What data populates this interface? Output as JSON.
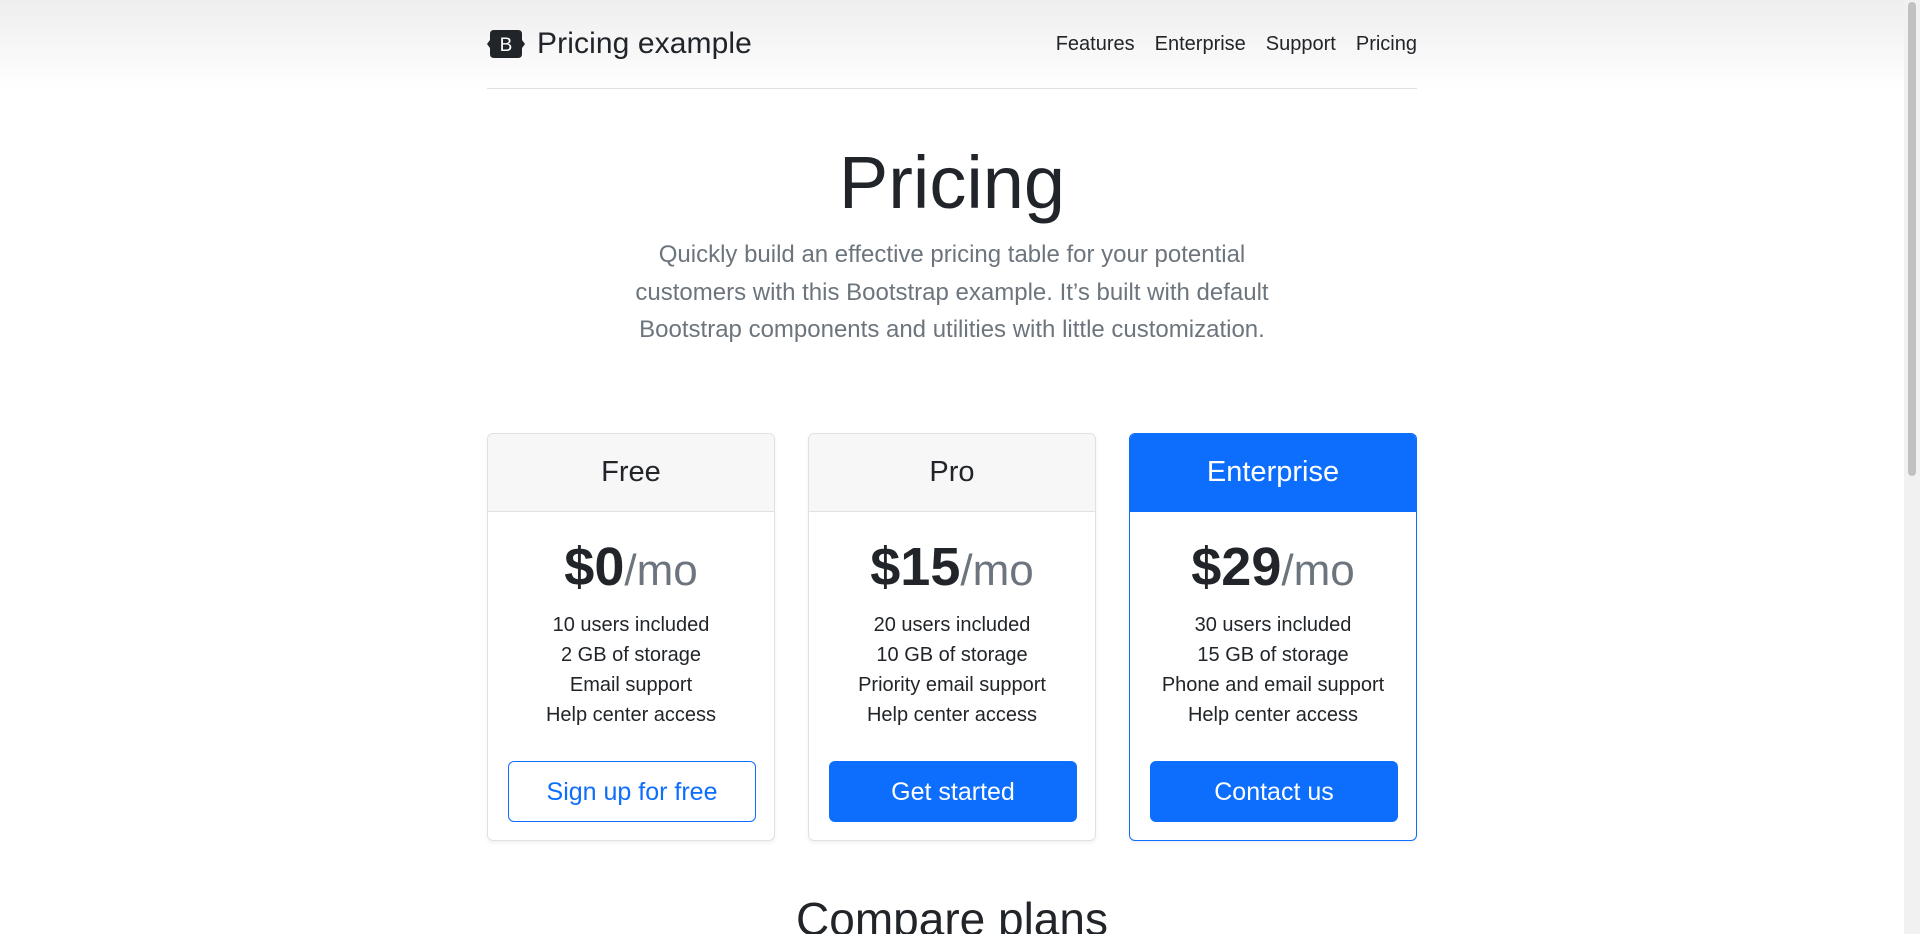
{
  "header": {
    "brand_letter": "B",
    "brand": "Pricing example",
    "nav": [
      "Features",
      "Enterprise",
      "Support",
      "Pricing"
    ]
  },
  "hero": {
    "title": "Pricing",
    "lead": "Quickly build an effective pricing table for your potential customers with this Bootstrap example. It’s built with default Bootstrap components and utilities with little customization."
  },
  "plans": [
    {
      "name": "Free",
      "price": "$0",
      "per": "/mo",
      "features": [
        "10 users included",
        "2 GB of storage",
        "Email support",
        "Help center access"
      ],
      "cta": "Sign up for free"
    },
    {
      "name": "Pro",
      "price": "$15",
      "per": "/mo",
      "features": [
        "20 users included",
        "10 GB of storage",
        "Priority email support",
        "Help center access"
      ],
      "cta": "Get started"
    },
    {
      "name": "Enterprise",
      "price": "$29",
      "per": "/mo",
      "features": [
        "30 users included",
        "15 GB of storage",
        "Phone and email support",
        "Help center access"
      ],
      "cta": "Contact us"
    }
  ],
  "compare": {
    "title": "Compare plans"
  },
  "colors": {
    "primary": "#0d6efd",
    "muted": "#6c757d",
    "text": "#212529"
  },
  "icons": {
    "brand": "bootstrap-logo-icon"
  }
}
